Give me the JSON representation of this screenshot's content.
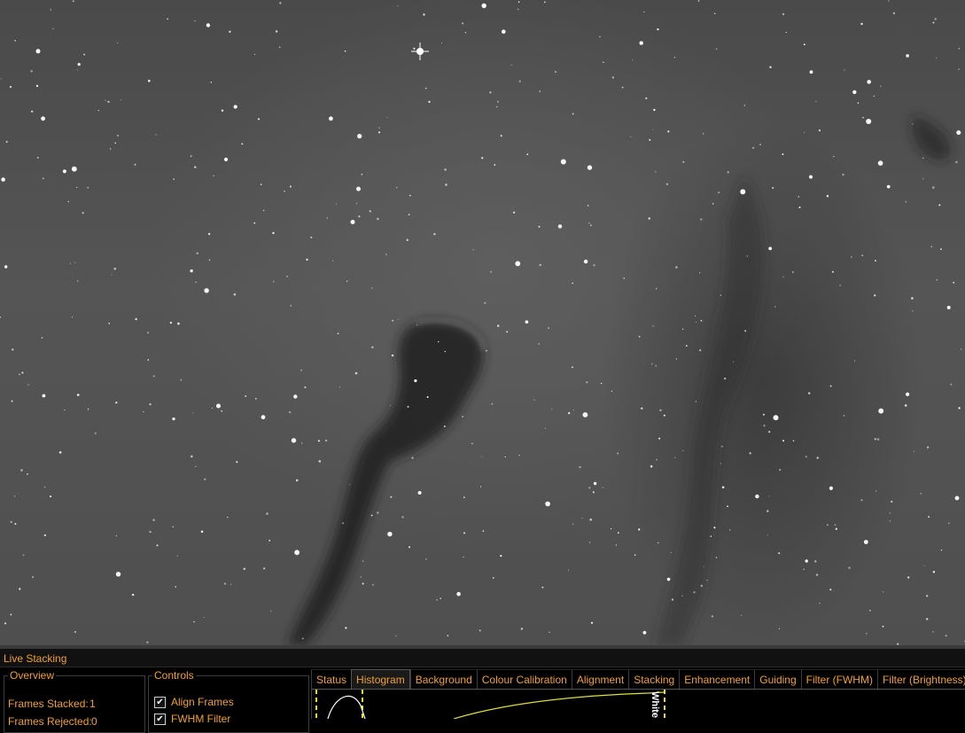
{
  "panel": {
    "title": "Live Stacking"
  },
  "overview": {
    "legend": "Overview",
    "frames_stacked_label": "Frames Stacked:",
    "frames_stacked_value": "1",
    "frames_rejected_label": "Frames Rejected:",
    "frames_rejected_value": "0"
  },
  "controls": {
    "legend": "Controls",
    "align_frames": {
      "label": "Align Frames",
      "checked": true
    },
    "fwhm_filter": {
      "label": "FWHM Filter",
      "checked": true
    }
  },
  "tabs": [
    {
      "label": "Status",
      "active": false
    },
    {
      "label": "Histogram",
      "active": true
    },
    {
      "label": "Background",
      "active": false
    },
    {
      "label": "Colour Calibration",
      "active": false
    },
    {
      "label": "Alignment",
      "active": false
    },
    {
      "label": "Stacking",
      "active": false
    },
    {
      "label": "Enhancement",
      "active": false
    },
    {
      "label": "Guiding",
      "active": false
    },
    {
      "label": "Filter (FWHM)",
      "active": false
    },
    {
      "label": "Filter (Brightness)",
      "active": false
    }
  ],
  "histogram": {
    "white_marker_label": "White"
  },
  "colors": {
    "accent": "#f0a030",
    "marker": "#e8e020",
    "curve": "#e0e040"
  }
}
